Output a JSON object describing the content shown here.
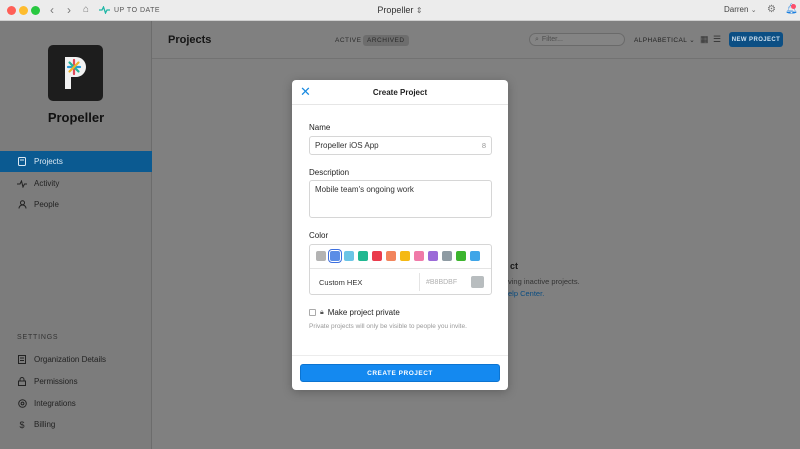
{
  "window": {
    "title": "Propeller",
    "sync_status": "UP TO DATE",
    "user_name": "Darren"
  },
  "sidebar": {
    "workspace_name": "Propeller",
    "nav": [
      {
        "label": "Projects",
        "icon": "projects-icon",
        "active": true
      },
      {
        "label": "Activity",
        "icon": "activity-icon",
        "active": false
      },
      {
        "label": "People",
        "icon": "people-icon",
        "active": false
      }
    ],
    "settings_heading": "SETTINGS",
    "settings": [
      {
        "label": "Organization Details",
        "icon": "building-icon"
      },
      {
        "label": "Permissions",
        "icon": "lock-icon"
      },
      {
        "label": "Integrations",
        "icon": "integrations-icon"
      },
      {
        "label": "Billing",
        "icon": "dollar-icon"
      }
    ]
  },
  "main": {
    "title": "Projects",
    "tabs": [
      {
        "label": "ACTIVE",
        "selected": false
      },
      {
        "label": "ARCHIVED",
        "selected": true
      }
    ],
    "filter_placeholder": "Filter...",
    "sort_label": "ALPHABETICAL",
    "new_project_label": "NEW PROJECT",
    "empty_state": {
      "title_fragment": "ct",
      "text_fragment": "ving inactive projects.",
      "link_fragment": "elp Center."
    }
  },
  "modal": {
    "title": "Create Project",
    "name_label": "Name",
    "name_value": "Propeller iOS App",
    "name_count": "8",
    "description_label": "Description",
    "description_value": "Mobile team's ongoing work",
    "color_label": "Color",
    "swatches": [
      "#b3b3b3",
      "#5b8de6",
      "#6cc5e6",
      "#20b891",
      "#ea3b4c",
      "#f2845c",
      "#f5b914",
      "#f07aa8",
      "#9b6ad8",
      "#8e9ba3",
      "#3cb52e",
      "#3fa5e8"
    ],
    "selected_swatch_index": 1,
    "custom_hex_label": "Custom HEX",
    "custom_hex_placeholder": "#B8BDBF",
    "custom_hex_preview": "#b8bdbf",
    "private_label": "Make project private",
    "private_checked": false,
    "private_hint": "Private projects will only be visible to people you invite.",
    "create_label": "CREATE PROJECT"
  },
  "colors": {
    "accent": "#1489f0",
    "sidebar_active": "#0b5a91"
  }
}
